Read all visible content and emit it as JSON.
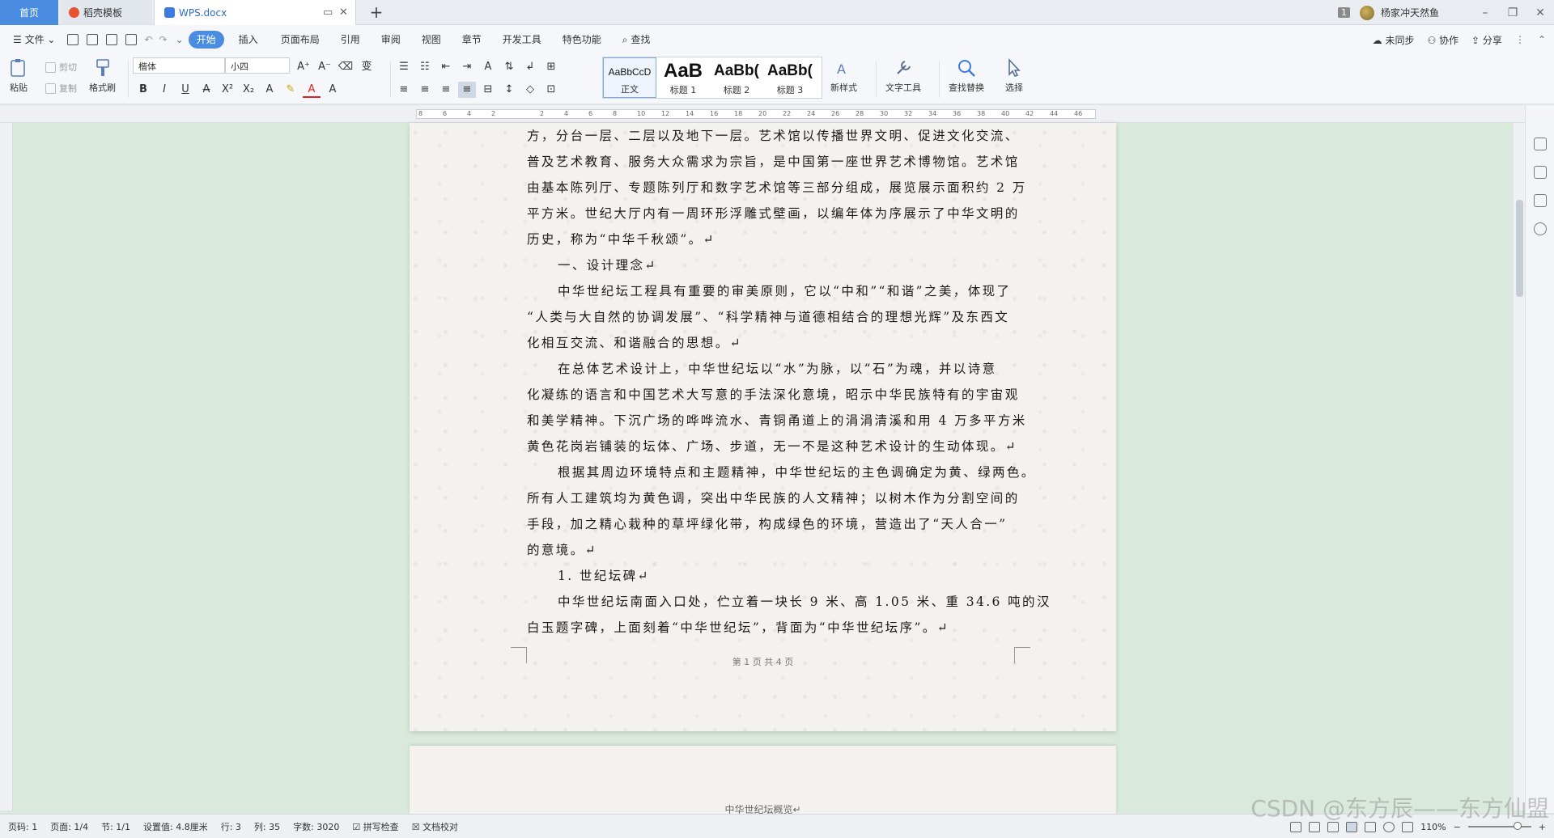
{
  "tabs": {
    "home": "首页",
    "template": "稻壳模板",
    "doc": "WPS.docx",
    "new_tab": "+"
  },
  "titlebar": {
    "badge": "1",
    "user": "杨家冲天然鱼",
    "minimize": "–",
    "restore": "❐",
    "close": "✕"
  },
  "menu": {
    "file": "文件",
    "items": [
      "开始",
      "插入",
      "页面布局",
      "引用",
      "审阅",
      "视图",
      "章节",
      "开发工具",
      "特色功能"
    ],
    "search": "查找",
    "sync": "未同步",
    "collab": "协作",
    "share": "分享"
  },
  "ribbon": {
    "paste": "粘贴",
    "cut": "剪切",
    "copy": "复制",
    "format_painter": "格式刷",
    "font_name": "楷体",
    "font_size": "小四",
    "styles": [
      {
        "preview": "AaBbCcD",
        "name": "正文"
      },
      {
        "preview": "AaB",
        "name": "标题 1"
      },
      {
        "preview": "AaBb(",
        "name": "标题 2"
      },
      {
        "preview": "AaBb(",
        "name": "标题 3"
      }
    ],
    "new_style": "新样式",
    "text_tools": "文字工具",
    "find_replace": "查找替换",
    "select": "选择"
  },
  "document": {
    "paragraphs": [
      {
        "text": "方，分台一层、二层以及地下一层。艺术馆以传播世界文明、促进文化交流、",
        "indent": false
      },
      {
        "text": "普及艺术教育、服务大众需求为宗旨，是中国第一座世界艺术博物馆。艺术馆",
        "indent": false
      },
      {
        "text": "由基本陈列厅、专题陈列厅和数字艺术馆等三部分组成，展览展示面积约 2 万",
        "indent": false
      },
      {
        "text": "平方米。世纪大厅内有一周环形浮雕式壁画，以编年体为序展示了中华文明的",
        "indent": false
      },
      {
        "text": "历史，称为“中华千秋颂”。↵",
        "indent": false
      },
      {
        "text": "一、设计理念↵",
        "indent": true
      },
      {
        "text": "中华世纪坛工程具有重要的审美原则，它以“中和”“和谐”之美，体现了",
        "indent": true
      },
      {
        "text": "“人类与大自然的协调发展”、“科学精神与道德相结合的理想光辉”及东西文",
        "indent": false
      },
      {
        "text": "化相互交流、和谐融合的思想。↵",
        "indent": false
      },
      {
        "text": "在总体艺术设计上，中华世纪坛以“水”为脉，以“石”为魂，并以诗意",
        "indent": true
      },
      {
        "text": "化凝练的语言和中国艺术大写意的手法深化意境，昭示中华民族特有的宇宙观",
        "indent": false
      },
      {
        "text": "和美学精神。下沉广场的哗哗流水、青铜甬道上的涓涓清溪和用 4 万多平方米",
        "indent": false
      },
      {
        "text": "黄色花岗岩铺装的坛体、广场、步道，无一不是这种艺术设计的生动体现。↵",
        "indent": false
      },
      {
        "text": "根据其周边环境特点和主题精神，中华世纪坛的主色调确定为黄、绿两色。",
        "indent": true
      },
      {
        "text": "所有人工建筑均为黄色调，突出中华民族的人文精神；以树木作为分割空间的",
        "indent": false
      },
      {
        "text": "手段，加之精心栽种的草坪绿化带，构成绿色的环境，营造出了“天人合一”",
        "indent": false
      },
      {
        "text": "的意境。↵",
        "indent": false
      },
      {
        "text": "1. 世纪坛碑↵",
        "indent": true
      },
      {
        "text": "中华世纪坛南面入口处，伫立着一块长 9 米、高 1.05 米、重 34.6 吨的汉",
        "indent": true
      },
      {
        "text": "白玉题字碑，上面刻着“中华世纪坛”，背面为“中华世纪坛序”。↵",
        "indent": false
      }
    ],
    "footer": "第 1 页 共 4 页",
    "next_page_header": "中华世纪坛概览↵"
  },
  "status": {
    "page_no": "页码: 1",
    "pages": "页面: 1/4",
    "section": "节: 1/1",
    "setting": "设置值: 4.8厘米",
    "row": "行: 3",
    "col": "列: 35",
    "word_count": "字数: 3020",
    "spell_check": "拼写检查",
    "doc_check": "文档校对",
    "zoom": "110%",
    "zoom_minus": "−",
    "zoom_plus": "+"
  },
  "watermark": "CSDN @东方辰——东方仙盟",
  "colors": {
    "accent": "#4a8de0",
    "workspace": "#d9eadc",
    "page": "#f4f2ef"
  }
}
